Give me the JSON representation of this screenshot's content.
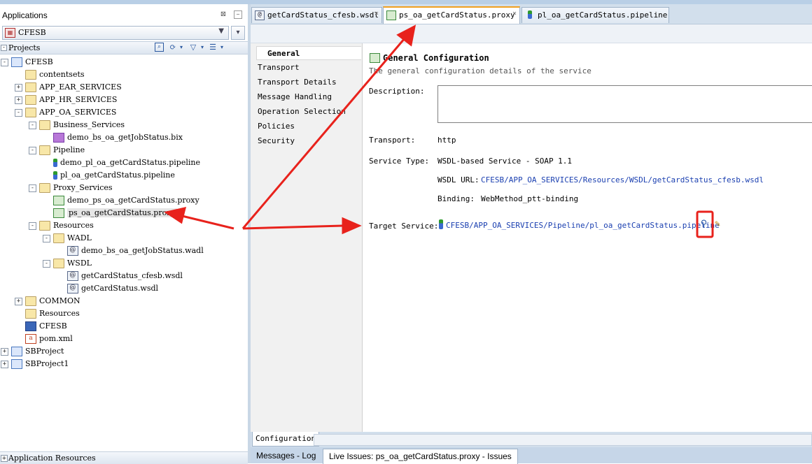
{
  "left_panel": {
    "title": "Applications",
    "app_selector": {
      "value": "CFESB",
      "icon": "application-icon"
    },
    "projects_label": "Projects",
    "tree": [
      {
        "label": "CFESB",
        "icon": "project-icon",
        "expander": "-"
      },
      {
        "label": "contentsets",
        "icon": "folder-icon",
        "expander": ""
      },
      {
        "label": "APP_EAR_SERVICES",
        "icon": "folder-icon",
        "expander": "+"
      },
      {
        "label": "APP_HR_SERVICES",
        "icon": "folder-icon",
        "expander": "+"
      },
      {
        "label": "APP_OA_SERVICES",
        "icon": "folder-icon",
        "expander": "-"
      },
      {
        "label": "Business_Services",
        "icon": "folder-icon",
        "expander": "-"
      },
      {
        "label": "demo_bs_oa_getJobStatus.bix",
        "icon": "business-service-icon",
        "expander": ""
      },
      {
        "label": "Pipeline",
        "icon": "folder-icon",
        "expander": "-"
      },
      {
        "label": "demo_pl_oa_getCardStatus.pipeline",
        "icon": "pipeline-icon",
        "expander": ""
      },
      {
        "label": "pl_oa_getCardStatus.pipeline",
        "icon": "pipeline-icon",
        "expander": ""
      },
      {
        "label": "Proxy_Services",
        "icon": "folder-icon",
        "expander": "-"
      },
      {
        "label": "demo_ps_oa_getCardStatus.proxy",
        "icon": "proxy-icon",
        "expander": ""
      },
      {
        "label": "ps_oa_getCardStatus.proxy",
        "icon": "proxy-icon",
        "expander": ""
      },
      {
        "label": "Resources",
        "icon": "folder-icon",
        "expander": "-"
      },
      {
        "label": "WADL",
        "icon": "folder-icon",
        "expander": "-"
      },
      {
        "label": "demo_bs_oa_getJobStatus.wadl",
        "icon": "wadl-icon",
        "expander": ""
      },
      {
        "label": "WSDL",
        "icon": "folder-icon",
        "expander": "-"
      },
      {
        "label": "getCardStatus_cfesb.wsdl",
        "icon": "wsdl-icon",
        "expander": ""
      },
      {
        "label": "getCardStatus.wsdl",
        "icon": "wsdl-icon",
        "expander": ""
      },
      {
        "label": "COMMON",
        "icon": "folder-icon",
        "expander": "+"
      },
      {
        "label": "Resources",
        "icon": "folder-icon",
        "expander": ""
      },
      {
        "label": "CFESB",
        "icon": "configuration-icon",
        "expander": ""
      },
      {
        "label": "pom.xml",
        "icon": "xml-file-icon",
        "expander": ""
      },
      {
        "label": "SBProject",
        "icon": "project-icon",
        "expander": "+"
      },
      {
        "label": "SBProject1",
        "icon": "project-icon",
        "expander": "+"
      }
    ],
    "app_resources_label": "Application Resources"
  },
  "editor_tabs": [
    {
      "label": "getCardStatus_cfesb.wsdl",
      "icon": "wsdl-icon",
      "close": "×",
      "active": false
    },
    {
      "label": "ps_oa_getCardStatus.proxy",
      "icon": "proxy-icon",
      "close": "×",
      "active": true
    },
    {
      "label": "pl_oa_getCardStatus.pipeline",
      "icon": "pipeline-icon",
      "close": "",
      "active": false
    }
  ],
  "nav": [
    "General",
    "Transport",
    "Transport Details",
    "Message Handling",
    "Operation Selection",
    "Policies",
    "Security"
  ],
  "general": {
    "title": "General Configuration",
    "subtitle": "The general configuration details of the service",
    "description_label": "Description:",
    "description_value": "",
    "transport_label": "Transport:",
    "transport_value": "http",
    "service_type_label": "Service Type:",
    "service_type_value": "WSDL-based Service - SOAP 1.1",
    "wsdl_url_label": "WSDL URL:",
    "wsdl_url_value": "CFESB/APP_OA_SERVICES/Resources/WSDL/getCardStatus_cfesb.wsdl",
    "binding_label": "Binding:",
    "binding_value": "WebMethod_ptt-binding",
    "target_service_label": "Target Service:",
    "target_service_value": "CFESB/APP_OA_SERVICES/Pipeline/pl_oa_getCardStatus.pipeline"
  },
  "config_tab": "Configuration",
  "bottom_tabs": [
    {
      "label": "Messages - Log",
      "active": false
    },
    {
      "label": "Live Issues: ps_oa_getCardStatus.proxy - Issues",
      "active": true
    }
  ],
  "colors": {
    "link": "#1a3fb0",
    "annotation_red": "#e8221c",
    "active_tab_accent": "#f0a020"
  }
}
